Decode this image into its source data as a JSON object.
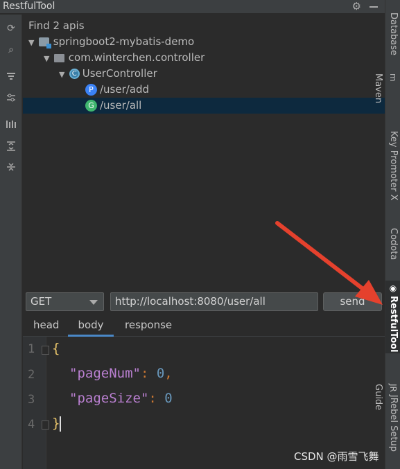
{
  "window": {
    "title": "RestfulTool"
  },
  "tree": {
    "summary": "Find 2 apis",
    "project": "springboot2-mybatis-demo",
    "package": "com.winterchen.controller",
    "controller": {
      "badge": "C",
      "name": "UserController"
    },
    "endpoints": [
      {
        "badge": "P",
        "path": "/user/add",
        "color": "#3b82f6"
      },
      {
        "badge": "G",
        "path": "/user/all",
        "color": "#3fb66f",
        "selected": true
      }
    ]
  },
  "request": {
    "method": "GET",
    "url": "http://localhost:8080/user/all",
    "send_label": "send"
  },
  "tabs": [
    "head",
    "body",
    "response"
  ],
  "active_tab": "body",
  "editor": {
    "line_numbers": [
      "1",
      "2",
      "3",
      "4"
    ],
    "open_brace": "{",
    "close_brace": "}",
    "fields": [
      {
        "key": "\"pageNum\"",
        "sep": ": ",
        "value": "0",
        "trail": ","
      },
      {
        "key": "\"pageSize\"",
        "sep": ": ",
        "value": "0",
        "trail": ""
      }
    ]
  },
  "right_tabs": [
    "Database",
    "Maven",
    "Key Promoter X",
    "Codota",
    "RestfulTool",
    "JRebel Setup Guide"
  ],
  "right_tab_icons": {
    "maven": "m",
    "jrebel": "JR"
  },
  "watermark": "CSDN @雨雪飞舞",
  "colors": {
    "accent": "#4a88c7",
    "selection": "#0d293e",
    "arrow": "#e5412d"
  }
}
